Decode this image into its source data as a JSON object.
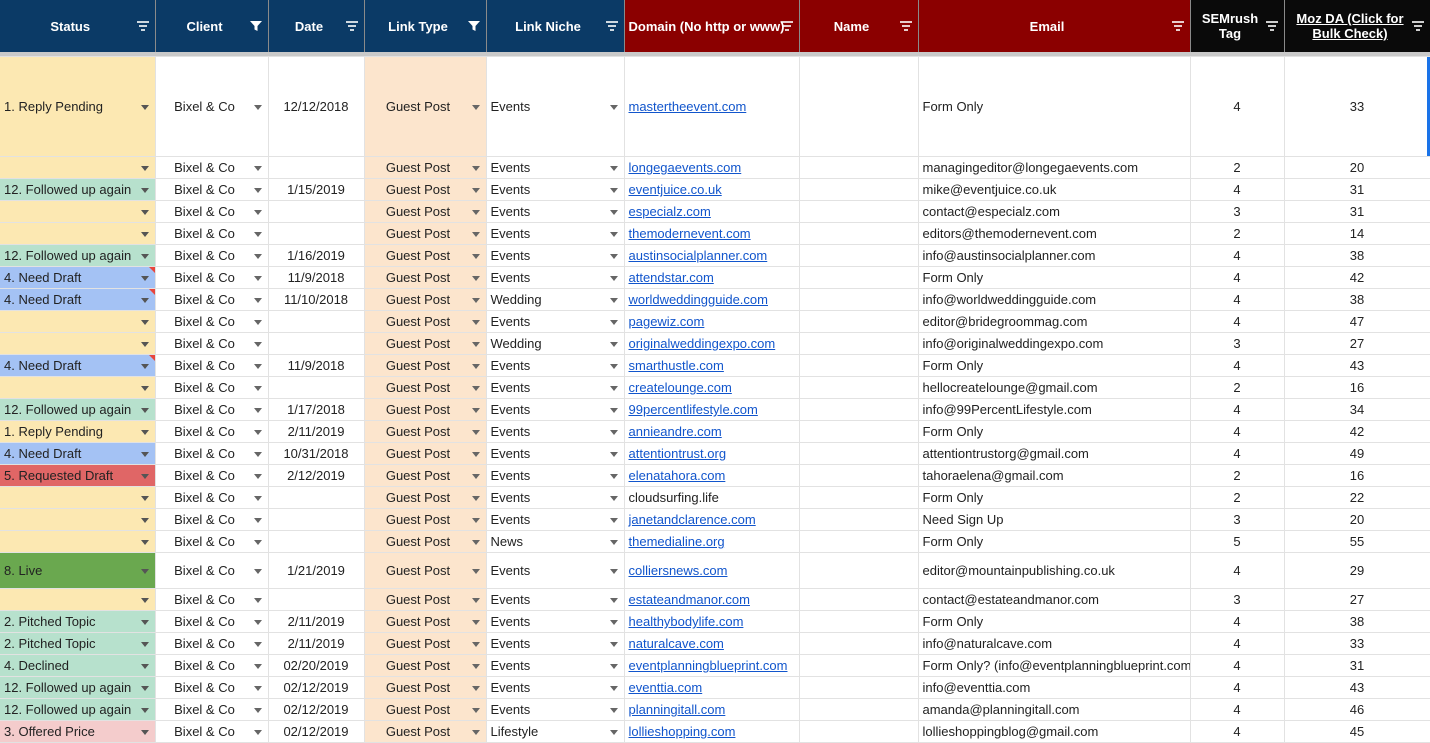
{
  "header": [
    {
      "label": "Status",
      "bg": "navy",
      "filter": "lines",
      "align": "center"
    },
    {
      "label": "Client",
      "bg": "navy",
      "filter": "funnel",
      "align": "center"
    },
    {
      "label": "Date",
      "bg": "navy",
      "filter": "lines",
      "align": "center"
    },
    {
      "label": "Link Type",
      "bg": "navy",
      "filter": "funnel",
      "align": "center"
    },
    {
      "label": "Link Niche",
      "bg": "navy",
      "filter": "lines",
      "align": "center"
    },
    {
      "label": "Domain (No http or www)",
      "bg": "red",
      "filter": "lines",
      "align": "left"
    },
    {
      "label": "Name",
      "bg": "red",
      "filter": "lines",
      "align": "center"
    },
    {
      "label": "Email",
      "bg": "red",
      "filter": "lines",
      "align": "center"
    },
    {
      "label": "SEMrush Tag",
      "bg": "black",
      "filter": "lines",
      "align": "center",
      "wrap": true
    },
    {
      "label": "Moz DA      (Click for Bulk Check)",
      "bg": "black",
      "filter": "lines",
      "align": "center",
      "wrap": true,
      "link": true
    }
  ],
  "colors": {
    "reply_pending": "#fce8b2",
    "followed_up": "#b7e1cd",
    "need_draft": "#a4c2f4",
    "requested_draft": "#e06666",
    "live": "#6aa84f",
    "pitched_topic": "#b7e1cd",
    "declined": "#b7e1cd",
    "offered_price": "#f4cccc",
    "guest_post": "#fce5cd"
  },
  "rows": [
    {
      "status": "1. Reply Pending",
      "sc": "#fce8b2",
      "client": "Bixel & Co",
      "date": "12/12/2018",
      "type": "Guest Post",
      "niche": "Events",
      "domain": "mastertheevent.com",
      "name": "",
      "email": "Form Only",
      "sem": "4",
      "moz": "33",
      "tall": true
    },
    {
      "status": "",
      "sc": "#fce8b2",
      "client": "Bixel & Co",
      "date": "",
      "type": "Guest Post",
      "niche": "Events",
      "domain": "longegaevents.com",
      "name": "",
      "email": "managingeditor@longegaevents.com",
      "sem": "2",
      "moz": "20"
    },
    {
      "status": "12. Followed up again",
      "sc": "#b7e1cd",
      "client": "Bixel & Co",
      "date": "1/15/2019",
      "type": "Guest Post",
      "niche": "Events",
      "domain": "eventjuice.co.uk",
      "name": "",
      "email": "mike@eventjuice.co.uk",
      "sem": "4",
      "moz": "31"
    },
    {
      "status": "",
      "sc": "#fce8b2",
      "client": "Bixel & Co",
      "date": "",
      "type": "Guest Post",
      "niche": "Events",
      "domain": "especialz.com",
      "name": "",
      "email": "contact@especialz.com",
      "sem": "3",
      "moz": "31"
    },
    {
      "status": "",
      "sc": "#fce8b2",
      "client": "Bixel & Co",
      "date": "",
      "type": "Guest Post",
      "niche": "Events",
      "domain": "themodernevent.com",
      "name": "",
      "email": "editors@themodernevent.com",
      "sem": "2",
      "moz": "14"
    },
    {
      "status": "12. Followed up again",
      "sc": "#b7e1cd",
      "client": "Bixel & Co",
      "date": "1/16/2019",
      "type": "Guest Post",
      "niche": "Events",
      "domain": "austinsocialplanner.com",
      "name": "",
      "email": "info@austinsocialplanner.com",
      "sem": "4",
      "moz": "38"
    },
    {
      "status": "4. Need Draft",
      "sc": "#a4c2f4",
      "client": "Bixel & Co",
      "date": "11/9/2018",
      "type": "Guest Post",
      "niche": "Events",
      "domain": "attendstar.com",
      "name": "",
      "email": "Form Only",
      "sem": "4",
      "moz": "42",
      "note": true
    },
    {
      "status": "4. Need Draft",
      "sc": "#a4c2f4",
      "client": "Bixel & Co",
      "date": "11/10/2018",
      "type": "Guest Post",
      "niche": "Wedding",
      "domain": "worldweddingguide.com",
      "name": "",
      "email": "info@worldweddingguide.com",
      "sem": "4",
      "moz": "38",
      "note": true
    },
    {
      "status": "",
      "sc": "#fce8b2",
      "client": "Bixel & Co",
      "date": "",
      "type": "Guest Post",
      "niche": "Events",
      "domain": "pagewiz.com",
      "name": "",
      "email": "editor@bridegroommag.com",
      "sem": "4",
      "moz": "47"
    },
    {
      "status": "",
      "sc": "#fce8b2",
      "client": "Bixel & Co",
      "date": "",
      "type": "Guest Post",
      "niche": "Wedding",
      "domain": "originalweddingexpo.com",
      "name": "",
      "email": " info@originalweddingexpo.com",
      "sem": "3",
      "moz": "27"
    },
    {
      "status": "4. Need Draft",
      "sc": "#a4c2f4",
      "client": "Bixel & Co",
      "date": "11/9/2018",
      "type": "Guest Post",
      "niche": "Events",
      "domain": "smarthustle.com",
      "name": "",
      "email": "Form Only",
      "sem": "4",
      "moz": "43",
      "note": true
    },
    {
      "status": "",
      "sc": "#fce8b2",
      "client": "Bixel & Co",
      "date": "",
      "type": "Guest Post",
      "niche": "Events",
      "domain": "createlounge.com",
      "name": "",
      "email": "hellocreatelounge@gmail.com",
      "sem": "2",
      "moz": "16"
    },
    {
      "status": "12. Followed up again",
      "sc": "#b7e1cd",
      "client": "Bixel & Co",
      "date": "1/17/2018",
      "type": "Guest Post",
      "niche": "Events",
      "domain": "99percentlifestyle.com",
      "name": "",
      "email": "info@99PercentLifestyle.com",
      "sem": "4",
      "moz": "34"
    },
    {
      "status": "1. Reply Pending",
      "sc": "#fce8b2",
      "client": "Bixel & Co",
      "date": "2/11/2019",
      "type": "Guest Post",
      "niche": "Events",
      "domain": "annieandre.com",
      "name": "",
      "email": "Form Only",
      "sem": "4",
      "moz": "42"
    },
    {
      "status": "4. Need Draft",
      "sc": "#a4c2f4",
      "client": "Bixel & Co",
      "date": "10/31/2018",
      "type": "Guest Post",
      "niche": "Events",
      "domain": "attentiontrust.org",
      "name": "",
      "email": "attentiontrustorg@gmail.com",
      "sem": "4",
      "moz": "49"
    },
    {
      "status": "5. Requested Draft",
      "sc": "#e06666",
      "client": "Bixel & Co",
      "date": "2/12/2019",
      "type": "Guest Post",
      "niche": "Events",
      "domain": "elenatahora.com",
      "name": "",
      "email": "tahoraelena@gmail.com",
      "sem": "2",
      "moz": "16"
    },
    {
      "status": "",
      "sc": "#fce8b2",
      "client": "Bixel & Co",
      "date": "",
      "type": "Guest Post",
      "niche": "Events",
      "domain": "cloudsurfing.life",
      "plain": true,
      "name": "",
      "email": "Form Only",
      "sem": "2",
      "moz": "22"
    },
    {
      "status": "",
      "sc": "#fce8b2",
      "client": "Bixel & Co",
      "date": "",
      "type": "Guest Post",
      "niche": "Events",
      "domain": "janetandclarence.com",
      "name": "",
      "email": "Need Sign Up",
      "sem": "3",
      "moz": "20"
    },
    {
      "status": "",
      "sc": "#fce8b2",
      "client": "Bixel & Co",
      "date": "",
      "type": "Guest Post",
      "niche": "News",
      "domain": "themedialine.org",
      "name": "",
      "email": "Form Only",
      "sem": "5",
      "moz": "55"
    },
    {
      "status": "8. Live",
      "sc": "#6aa84f",
      "client": "Bixel & Co",
      "date": "1/21/2019",
      "type": "Guest Post",
      "niche": "Events",
      "domain": "colliersnews.com",
      "name": "",
      "email": "editor@mountainpublishing.co.uk",
      "sem": "4",
      "moz": "29",
      "mid": true
    },
    {
      "status": "",
      "sc": "#fce8b2",
      "client": "Bixel & Co",
      "date": "",
      "type": "Guest Post",
      "niche": "Events",
      "domain": "estateandmanor.com",
      "name": "",
      "email": "contact@estateandmanor.com",
      "sem": "3",
      "moz": "27"
    },
    {
      "status": "2. Pitched Topic",
      "sc": "#b7e1cd",
      "client": "Bixel & Co",
      "date": "2/11/2019",
      "type": "Guest Post",
      "niche": "Events",
      "domain": "healthybodylife.com",
      "name": "",
      "email": "Form Only",
      "sem": "4",
      "moz": "38"
    },
    {
      "status": "2. Pitched Topic",
      "sc": "#b7e1cd",
      "client": "Bixel & Co",
      "date": "2/11/2019",
      "type": "Guest Post",
      "niche": "Events",
      "domain": "naturalcave.com",
      "name": "",
      "email": "info@naturalcave.com",
      "sem": "4",
      "moz": "33"
    },
    {
      "status": "4. Declined",
      "sc": "#b7e1cd",
      "client": "Bixel & Co",
      "date": "02/20/2019",
      "type": "Guest Post",
      "niche": "Events",
      "domain": "eventplanningblueprint.com",
      "name": "",
      "email": "Form Only? (info@eventplanningblueprint.com",
      "sem": "4",
      "moz": "31"
    },
    {
      "status": "12. Followed up again",
      "sc": "#b7e1cd",
      "client": "Bixel & Co",
      "date": "02/12/2019",
      "type": "Guest Post",
      "niche": "Events",
      "domain": "eventtia.com",
      "name": "",
      "email": "info@eventtia.com",
      "sem": "4",
      "moz": "43"
    },
    {
      "status": "12. Followed up again",
      "sc": "#b7e1cd",
      "client": "Bixel & Co",
      "date": "02/12/2019",
      "type": "Guest Post",
      "niche": "Events",
      "domain": "planningitall.com",
      "name": "",
      "email": "amanda@planningitall.com",
      "sem": "4",
      "moz": "46"
    },
    {
      "status": "3. Offered Price",
      "sc": "#f4cccc",
      "client": "Bixel & Co",
      "date": "02/12/2019",
      "type": "Guest Post",
      "niche": "Lifestyle",
      "domain": "lollieshopping.com",
      "name": "",
      "email": "lollieshoppingblog@gmail.com",
      "sem": "4",
      "moz": "45"
    }
  ]
}
